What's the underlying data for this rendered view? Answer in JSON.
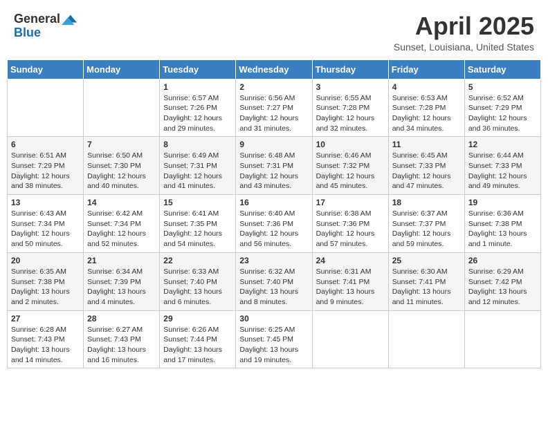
{
  "header": {
    "logo_general": "General",
    "logo_blue": "Blue",
    "title": "April 2025",
    "subtitle": "Sunset, Louisiana, United States"
  },
  "weekdays": [
    "Sunday",
    "Monday",
    "Tuesday",
    "Wednesday",
    "Thursday",
    "Friday",
    "Saturday"
  ],
  "weeks": [
    [
      {
        "day": "",
        "info": ""
      },
      {
        "day": "",
        "info": ""
      },
      {
        "day": "1",
        "info": "Sunrise: 6:57 AM\nSunset: 7:26 PM\nDaylight: 12 hours and 29 minutes."
      },
      {
        "day": "2",
        "info": "Sunrise: 6:56 AM\nSunset: 7:27 PM\nDaylight: 12 hours and 31 minutes."
      },
      {
        "day": "3",
        "info": "Sunrise: 6:55 AM\nSunset: 7:28 PM\nDaylight: 12 hours and 32 minutes."
      },
      {
        "day": "4",
        "info": "Sunrise: 6:53 AM\nSunset: 7:28 PM\nDaylight: 12 hours and 34 minutes."
      },
      {
        "day": "5",
        "info": "Sunrise: 6:52 AM\nSunset: 7:29 PM\nDaylight: 12 hours and 36 minutes."
      }
    ],
    [
      {
        "day": "6",
        "info": "Sunrise: 6:51 AM\nSunset: 7:29 PM\nDaylight: 12 hours and 38 minutes."
      },
      {
        "day": "7",
        "info": "Sunrise: 6:50 AM\nSunset: 7:30 PM\nDaylight: 12 hours and 40 minutes."
      },
      {
        "day": "8",
        "info": "Sunrise: 6:49 AM\nSunset: 7:31 PM\nDaylight: 12 hours and 41 minutes."
      },
      {
        "day": "9",
        "info": "Sunrise: 6:48 AM\nSunset: 7:31 PM\nDaylight: 12 hours and 43 minutes."
      },
      {
        "day": "10",
        "info": "Sunrise: 6:46 AM\nSunset: 7:32 PM\nDaylight: 12 hours and 45 minutes."
      },
      {
        "day": "11",
        "info": "Sunrise: 6:45 AM\nSunset: 7:33 PM\nDaylight: 12 hours and 47 minutes."
      },
      {
        "day": "12",
        "info": "Sunrise: 6:44 AM\nSunset: 7:33 PM\nDaylight: 12 hours and 49 minutes."
      }
    ],
    [
      {
        "day": "13",
        "info": "Sunrise: 6:43 AM\nSunset: 7:34 PM\nDaylight: 12 hours and 50 minutes."
      },
      {
        "day": "14",
        "info": "Sunrise: 6:42 AM\nSunset: 7:34 PM\nDaylight: 12 hours and 52 minutes."
      },
      {
        "day": "15",
        "info": "Sunrise: 6:41 AM\nSunset: 7:35 PM\nDaylight: 12 hours and 54 minutes."
      },
      {
        "day": "16",
        "info": "Sunrise: 6:40 AM\nSunset: 7:36 PM\nDaylight: 12 hours and 56 minutes."
      },
      {
        "day": "17",
        "info": "Sunrise: 6:38 AM\nSunset: 7:36 PM\nDaylight: 12 hours and 57 minutes."
      },
      {
        "day": "18",
        "info": "Sunrise: 6:37 AM\nSunset: 7:37 PM\nDaylight: 12 hours and 59 minutes."
      },
      {
        "day": "19",
        "info": "Sunrise: 6:36 AM\nSunset: 7:38 PM\nDaylight: 13 hours and 1 minute."
      }
    ],
    [
      {
        "day": "20",
        "info": "Sunrise: 6:35 AM\nSunset: 7:38 PM\nDaylight: 13 hours and 2 minutes."
      },
      {
        "day": "21",
        "info": "Sunrise: 6:34 AM\nSunset: 7:39 PM\nDaylight: 13 hours and 4 minutes."
      },
      {
        "day": "22",
        "info": "Sunrise: 6:33 AM\nSunset: 7:40 PM\nDaylight: 13 hours and 6 minutes."
      },
      {
        "day": "23",
        "info": "Sunrise: 6:32 AM\nSunset: 7:40 PM\nDaylight: 13 hours and 8 minutes."
      },
      {
        "day": "24",
        "info": "Sunrise: 6:31 AM\nSunset: 7:41 PM\nDaylight: 13 hours and 9 minutes."
      },
      {
        "day": "25",
        "info": "Sunrise: 6:30 AM\nSunset: 7:41 PM\nDaylight: 13 hours and 11 minutes."
      },
      {
        "day": "26",
        "info": "Sunrise: 6:29 AM\nSunset: 7:42 PM\nDaylight: 13 hours and 12 minutes."
      }
    ],
    [
      {
        "day": "27",
        "info": "Sunrise: 6:28 AM\nSunset: 7:43 PM\nDaylight: 13 hours and 14 minutes."
      },
      {
        "day": "28",
        "info": "Sunrise: 6:27 AM\nSunset: 7:43 PM\nDaylight: 13 hours and 16 minutes."
      },
      {
        "day": "29",
        "info": "Sunrise: 6:26 AM\nSunset: 7:44 PM\nDaylight: 13 hours and 17 minutes."
      },
      {
        "day": "30",
        "info": "Sunrise: 6:25 AM\nSunset: 7:45 PM\nDaylight: 13 hours and 19 minutes."
      },
      {
        "day": "",
        "info": ""
      },
      {
        "day": "",
        "info": ""
      },
      {
        "day": "",
        "info": ""
      }
    ]
  ]
}
